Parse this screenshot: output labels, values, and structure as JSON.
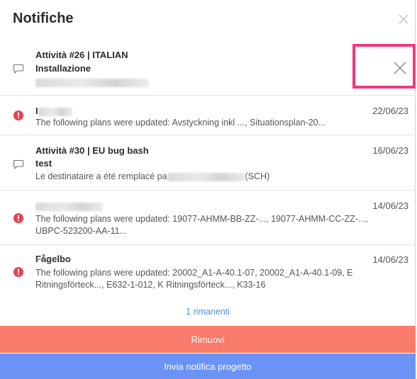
{
  "panel": {
    "title": "Notifiche",
    "close_icon": "close-icon"
  },
  "notifications": [
    {
      "icon": "comment-icon",
      "title": "Attività #26 | ITALIAN",
      "subtitle": "Installazione",
      "body": "",
      "date": "",
      "dismiss_icon": "close-icon"
    },
    {
      "icon": "alert-icon",
      "title": "I",
      "body": "The following plans were updated: Avstyckning inkl ..., Situationsplan-20...",
      "date": "22/06/23"
    },
    {
      "icon": "comment-icon",
      "title": "Attività #30 | EU bug bash",
      "subtitle": "test",
      "body_prefix": "Le destinataire a été remplacé pa",
      "body_suffix": "(SCH)",
      "date": "16/06/23"
    },
    {
      "icon": "alert-icon",
      "title": "",
      "body": "The following plans were updated: 19077-AHMM-BB-ZZ-..., 19077-AHMM-CC-ZZ-..., UBPC-523200-AA-11...",
      "date": "14/06/23"
    },
    {
      "icon": "alert-icon",
      "title": "Fågelbo",
      "body": "The following plans were updated: 20002_A1-A-40.1-07, 20002_A1-A-40.1-09, E Ritningsförteck..., E632-1-012, K Ritningsförteck..., K33-16",
      "date": "14/06/23"
    }
  ],
  "footer": {
    "remaining_label": "1 rimanenti",
    "remove_label": "Rimuovi",
    "send_label": "Invia notifica progetto"
  },
  "colors": {
    "remove_bg": "#f97b6b",
    "send_bg": "#6a93f5",
    "alert": "#e8414f",
    "link": "#4a90e2",
    "highlight": "#ef3a7b"
  }
}
